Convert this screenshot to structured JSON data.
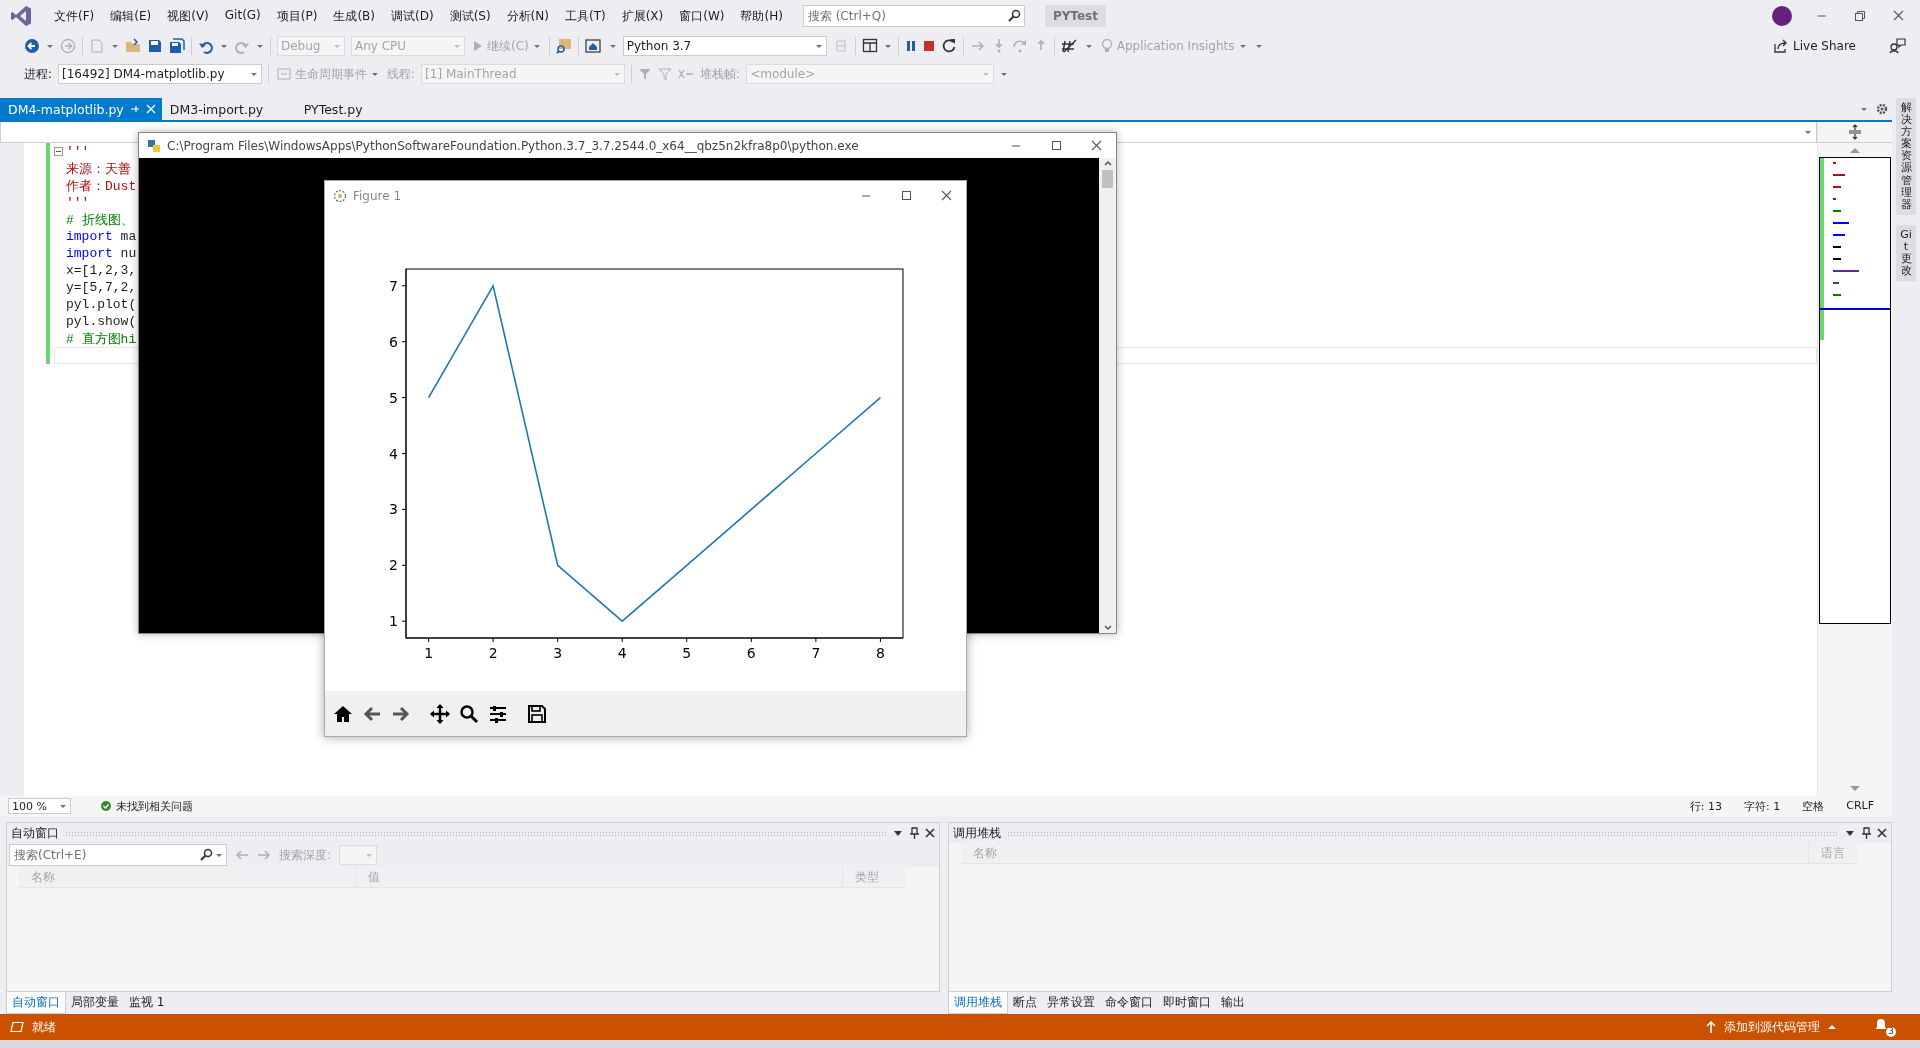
{
  "menu": {
    "items": [
      "文件(F)",
      "编辑(E)",
      "视图(V)",
      "Git(G)",
      "项目(P)",
      "生成(B)",
      "调试(D)",
      "测试(S)",
      "分析(N)",
      "工具(T)",
      "扩展(X)",
      "窗口(W)",
      "帮助(H)"
    ],
    "search": {
      "placeholder": "搜索 (Ctrl+Q)"
    },
    "solution": "PYTest"
  },
  "toolbar": {
    "configuration": "Debug",
    "platform": "Any CPU",
    "continue": "继续(C)",
    "environment": "Python 3.7",
    "insights": "Application Insights",
    "live_share": "Live Share"
  },
  "debug_bar": {
    "process_label": "进程:",
    "process": "[16492] DM4-matplotlib.py",
    "lifecycle": "生命周期事件",
    "thread_label": "线程:",
    "thread": "[1] MainThread",
    "stack_label": "堆栈帧:",
    "stack_frame": "<module>"
  },
  "tabs": [
    {
      "label": "DM4-matplotlib.py",
      "selected": true
    },
    {
      "label": "DM3-import.py",
      "selected": false
    },
    {
      "label": "PYTest.py",
      "selected": false
    }
  ],
  "code_lines": [
    {
      "fold_start": true,
      "current": false,
      "segments": [
        {
          "kind": "string",
          "text": "'''"
        }
      ]
    },
    {
      "fold_start": false,
      "current": false,
      "segments": [
        {
          "kind": "string",
          "text": "来源：天善"
        }
      ]
    },
    {
      "fold_start": false,
      "current": false,
      "segments": [
        {
          "kind": "string",
          "text": "作者：Dust"
        }
      ]
    },
    {
      "fold_start": false,
      "current": false,
      "segments": [
        {
          "kind": "string",
          "text": "'''"
        }
      ]
    },
    {
      "fold_start": false,
      "current": false,
      "segments": [
        {
          "kind": "comment",
          "text": "# 折线图、"
        }
      ]
    },
    {
      "fold_start": false,
      "current": false,
      "segments": [
        {
          "kind": "keyword",
          "text": "import"
        },
        {
          "kind": "plain",
          "text": " ma"
        }
      ]
    },
    {
      "fold_start": false,
      "current": false,
      "segments": [
        {
          "kind": "keyword",
          "text": "import"
        },
        {
          "kind": "plain",
          "text": " nu"
        }
      ]
    },
    {
      "fold_start": false,
      "current": false,
      "segments": [
        {
          "kind": "plain",
          "text": "x=[1,2,3,"
        }
      ]
    },
    {
      "fold_start": false,
      "current": false,
      "segments": [
        {
          "kind": "plain",
          "text": "y=[5,7,2,"
        }
      ]
    },
    {
      "fold_start": false,
      "current": false,
      "segments": [
        {
          "kind": "plain",
          "text": "pyl.plot("
        }
      ]
    },
    {
      "fold_start": false,
      "current": false,
      "segments": [
        {
          "kind": "plain",
          "text": "pyl.show("
        }
      ]
    },
    {
      "fold_start": false,
      "current": false,
      "segments": [
        {
          "kind": "comment",
          "text": "# 直方图hi"
        }
      ]
    },
    {
      "fold_start": false,
      "current": true
    }
  ],
  "console": {
    "title": "C:\\Program Files\\WindowsApps\\PythonSoftwareFoundation.Python.3.7_3.7.2544.0_x64__qbz5n2kfra8p0\\python.exe"
  },
  "figure": {
    "title": "Figure 1",
    "chart_data": {
      "type": "line",
      "x": [
        1,
        2,
        3,
        4,
        5,
        6,
        7,
        8
      ],
      "series": [
        {
          "color": "#1f77b4",
          "values": [
            5,
            7,
            2,
            1,
            2,
            3,
            4,
            5
          ]
        }
      ],
      "xlim": [
        0.65,
        8.35
      ],
      "ylim": [
        0.7,
        7.3
      ],
      "xticks": [
        1,
        2,
        3,
        4,
        5,
        6,
        7,
        8
      ],
      "yticks": [
        1,
        2,
        3,
        4,
        5,
        6,
        7
      ]
    }
  },
  "side_tabs": [
    "解决方案资源管理器",
    "Git 更改"
  ],
  "editor_status": {
    "zoom": "100 %",
    "issues": "未找到相关问题",
    "line": "行: 13",
    "column": "字符: 1",
    "indent": "空格",
    "line_ending": "CRLF"
  },
  "autos": {
    "title": "自动窗口",
    "search": {
      "placeholder": "搜索(Ctrl+E)"
    },
    "depth_label": "搜索深度:",
    "columns": [
      "名称",
      "值",
      "类型"
    ],
    "tabs": [
      {
        "label": "自动窗口",
        "selected": true
      },
      {
        "label": "局部变量",
        "selected": false
      },
      {
        "label": "监视 1",
        "selected": false
      }
    ]
  },
  "call_stack": {
    "title": "调用堆栈",
    "columns": [
      "名称",
      "语言"
    ],
    "tabs": [
      {
        "label": "调用堆栈",
        "selected": true
      },
      {
        "label": "断点",
        "selected": false
      },
      {
        "label": "异常设置",
        "selected": false
      },
      {
        "label": "命令窗口",
        "selected": false
      },
      {
        "label": "即时窗口",
        "selected": false
      },
      {
        "label": "输出",
        "selected": false
      }
    ]
  },
  "status_bar": {
    "state": "就绪",
    "source_control": "添加到源代码管理",
    "notifications": "3"
  }
}
